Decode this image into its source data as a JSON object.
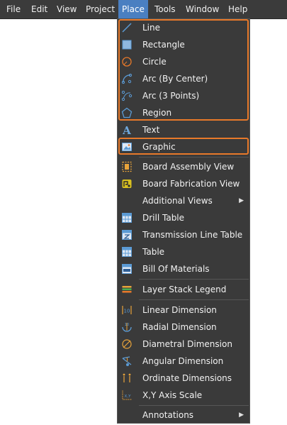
{
  "menubar": {
    "items": [
      {
        "label": "File"
      },
      {
        "label": "Edit"
      },
      {
        "label": "View"
      },
      {
        "label": "Project"
      },
      {
        "label": "Place"
      },
      {
        "label": "Tools"
      },
      {
        "label": "Window"
      },
      {
        "label": "Help"
      }
    ]
  },
  "place_menu": {
    "items": [
      {
        "label": "Line",
        "icon": "line-icon"
      },
      {
        "label": "Rectangle",
        "icon": "rectangle-icon"
      },
      {
        "label": "Circle",
        "icon": "circle-icon"
      },
      {
        "label": "Arc (By Center)",
        "icon": "arc-by-center-icon"
      },
      {
        "label": "Arc (3 Points)",
        "icon": "arc-3-points-icon"
      },
      {
        "label": "Region",
        "icon": "region-icon"
      },
      {
        "label": "Text",
        "icon": "text-icon"
      },
      {
        "label": "Graphic",
        "icon": "graphic-icon"
      },
      {
        "label": "Board Assembly View",
        "icon": "board-assembly-view-icon"
      },
      {
        "label": "Board Fabrication View",
        "icon": "board-fabrication-view-icon"
      },
      {
        "label": "Additional Views",
        "icon": "",
        "submenu": true
      },
      {
        "label": "Drill Table",
        "icon": "drill-table-icon"
      },
      {
        "label": "Transmission Line Table",
        "icon": "transmission-line-table-icon"
      },
      {
        "label": "Table",
        "icon": "table-icon"
      },
      {
        "label": "Bill Of Materials",
        "icon": "bill-of-materials-icon"
      },
      {
        "label": "Layer Stack Legend",
        "icon": "layer-stack-legend-icon"
      },
      {
        "label": "Linear Dimension",
        "icon": "linear-dimension-icon"
      },
      {
        "label": "Radial Dimension",
        "icon": "radial-dimension-icon"
      },
      {
        "label": "Diametral Dimension",
        "icon": "diametral-dimension-icon"
      },
      {
        "label": "Angular Dimension",
        "icon": "angular-dimension-icon"
      },
      {
        "label": "Ordinate Dimensions",
        "icon": "ordinate-dimensions-icon"
      },
      {
        "label": "X,Y Axis Scale",
        "icon": "xy-axis-scale-icon"
      },
      {
        "label": "Annotations",
        "icon": "",
        "submenu": true
      }
    ],
    "submenu_arrow": "▶"
  },
  "colors": {
    "menu_bg": "#3a3a3a",
    "menubar_bg": "#3b3b3b",
    "active_menu": "#4a7fc1",
    "highlight_outline": "#e8792a",
    "icon_blue": "#5b9bd5"
  }
}
